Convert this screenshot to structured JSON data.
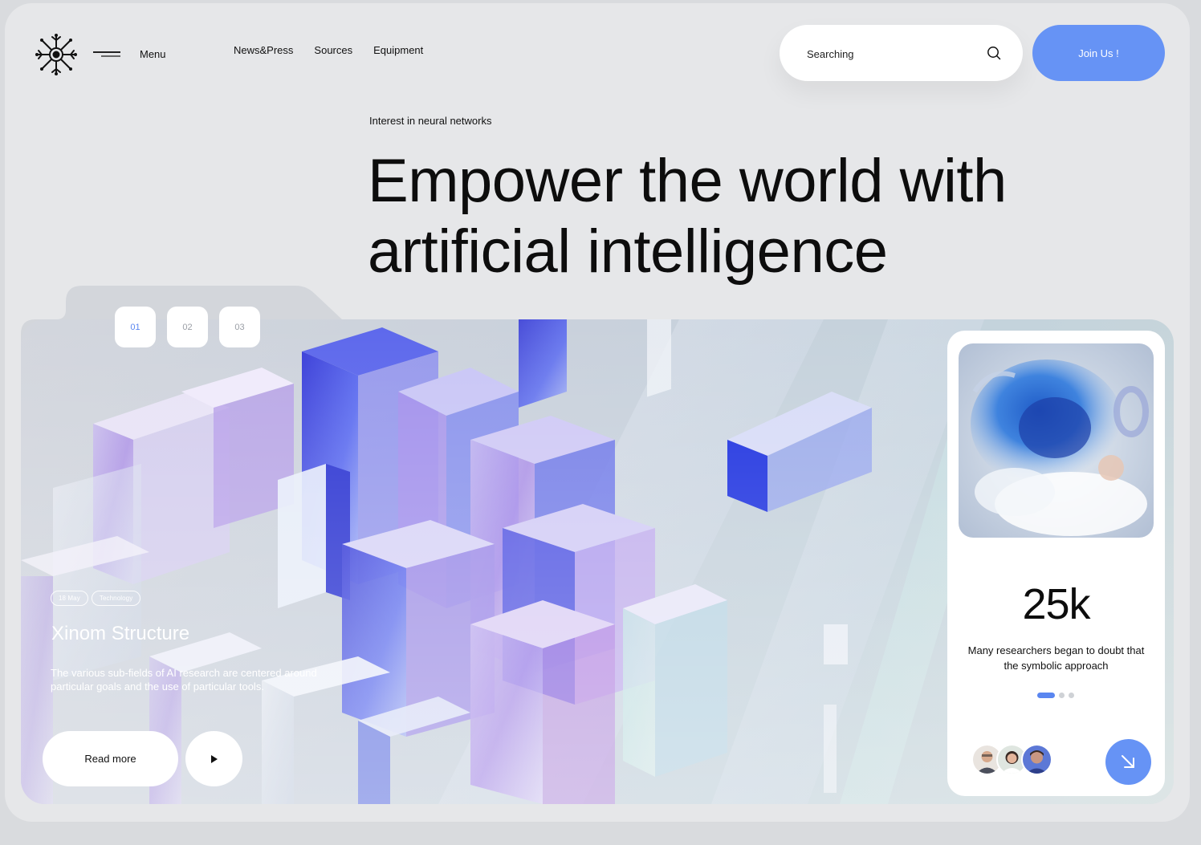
{
  "header": {
    "menu_label": "Menu",
    "nav": [
      "News&Press",
      "Sources",
      "Equipment"
    ],
    "search_placeholder": "Searching",
    "join_label": "Join Us !"
  },
  "hero": {
    "eyebrow": "Interest in neural networks",
    "headline_line1": "Empower the world with",
    "headline_line2": "artificial intelligence"
  },
  "slider": {
    "steps": [
      "01",
      "02",
      "03"
    ],
    "active_step": "01"
  },
  "feature": {
    "tags": [
      "18 May",
      "Technology"
    ],
    "title": "Xinom Structure",
    "description": "The various sub-fields of AI research are centered around particular goals and the use of particular tools.",
    "read_more_label": "Read more"
  },
  "stat_card": {
    "value": "25k",
    "description": "Many researchers began to doubt that the symbolic approach",
    "dots_total": 3,
    "dots_active": 1
  },
  "colors": {
    "accent": "#6693f5",
    "background": "#e6e7e9"
  },
  "icons": [
    "logo-icon",
    "menu-icon",
    "search-icon",
    "play-icon",
    "arrow-down-left-icon"
  ]
}
